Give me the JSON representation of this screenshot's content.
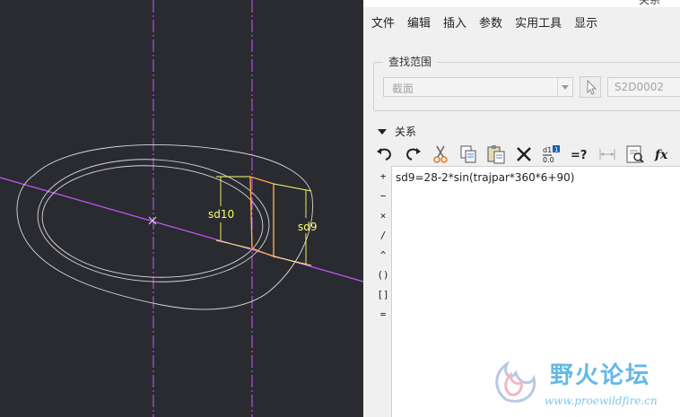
{
  "window": {
    "title": "关系"
  },
  "menu": [
    "文件",
    "编辑",
    "插入",
    "参数",
    "实用工具",
    "显示"
  ],
  "find_scope": {
    "label": "查找范围",
    "combo_value": "截面",
    "field_value": "S2D0002"
  },
  "relations": {
    "section_label": "关系",
    "operators": [
      "+",
      "−",
      "×",
      "/",
      "^",
      "()",
      "[]",
      "="
    ],
    "lines": [
      "sd9=28-2*sin(trajpar*360*6+90)"
    ]
  },
  "toolbar_icons": [
    "undo-icon",
    "redo-icon",
    "cut-icon",
    "copy-icon",
    "paste-icon",
    "delete-icon",
    "numeric-value-icon",
    "evaluate-icon",
    "dimension-icon",
    "verify-icon",
    "function-icon"
  ],
  "viewport": {
    "dimensions": [
      {
        "name": "sd10",
        "label": "sd10"
      },
      {
        "name": "sd9",
        "label": "sd9"
      }
    ],
    "colors": {
      "background": "#2a2b31",
      "axis": "#cc55ff",
      "profile": "#ffa84a",
      "dimension": "#ffff66",
      "sketch": "#d8d8d8"
    }
  },
  "watermark": {
    "name": "野火论坛",
    "url": "www.proewildfire.cn"
  }
}
